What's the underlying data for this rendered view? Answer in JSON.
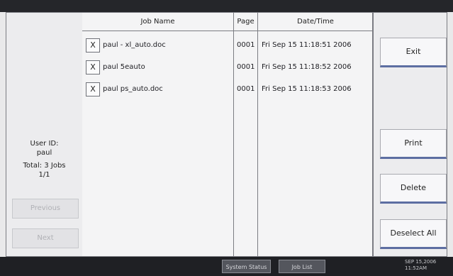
{
  "header": {
    "job_name": "Job Name",
    "page": "Page",
    "date_time": "Date/Time"
  },
  "jobs": [
    {
      "x_label": "X",
      "name": "paul - xl_auto.doc",
      "page": "0001",
      "date": "Fri Sep 15 11:18:51 2006"
    },
    {
      "x_label": "X",
      "name": "paul 5eauto",
      "page": "0001",
      "date": "Fri Sep 15 11:18:52 2006"
    },
    {
      "x_label": "X",
      "name": "paul ps_auto.doc",
      "page": "0001",
      "date": "Fri Sep 15 11:18:53 2006"
    }
  ],
  "user": {
    "label": "User ID:",
    "id": "paul",
    "total": "Total: 3 Jobs",
    "page_indicator": "1/1"
  },
  "nav": {
    "previous": "Previous",
    "next": "Next"
  },
  "actions": {
    "exit": "Exit",
    "print": "Print",
    "delete": "Delete",
    "deselect_all": "Deselect All"
  },
  "bottom": {
    "system_status": "System Status",
    "job_list": "Job List",
    "clock_date": "SEP 15,2006",
    "clock_time": "11:52AM"
  }
}
